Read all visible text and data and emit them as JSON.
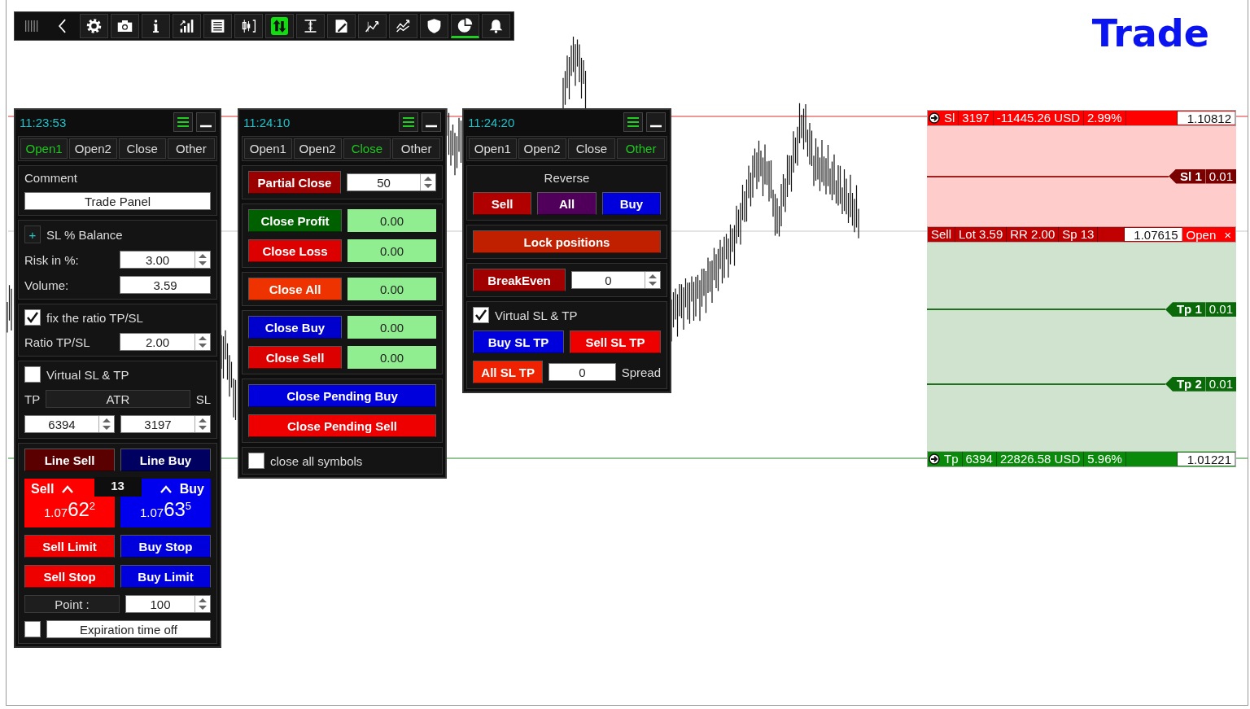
{
  "toolbar": {
    "buttons": [
      {
        "kind": "grip",
        "active": false,
        "marked": false
      },
      {
        "kind": "back",
        "active": false,
        "marked": false
      },
      {
        "kind": "gear",
        "active": false,
        "marked": false
      },
      {
        "kind": "camera",
        "active": false,
        "marked": false
      },
      {
        "kind": "info",
        "active": false,
        "marked": false
      },
      {
        "kind": "signal",
        "active": false,
        "marked": false
      },
      {
        "kind": "list",
        "active": false,
        "marked": false
      },
      {
        "kind": "candles",
        "active": false,
        "marked": false
      },
      {
        "kind": "updown",
        "active": true,
        "marked": false
      },
      {
        "kind": "ibeam",
        "active": false,
        "marked": false
      },
      {
        "kind": "edit",
        "active": false,
        "marked": false
      },
      {
        "kind": "trend",
        "active": false,
        "marked": false
      },
      {
        "kind": "trends",
        "active": false,
        "marked": false
      },
      {
        "kind": "shield",
        "active": false,
        "marked": false
      },
      {
        "kind": "pie",
        "active": false,
        "marked": true
      },
      {
        "kind": "bell",
        "active": false,
        "marked": false
      }
    ]
  },
  "title": "Trade",
  "panels": [
    {
      "time": "11:23:53",
      "tabs": [
        {
          "label": "Open1",
          "selected": true
        },
        {
          "label": "Open2",
          "selected": false
        },
        {
          "label": "Close",
          "selected": false
        },
        {
          "label": "Other",
          "selected": false
        }
      ],
      "sections": [
        {
          "rows": [
            [
              {
                "kind": "label",
                "text": "Comment"
              }
            ],
            [
              {
                "kind": "field",
                "value": "Trade Panel",
                "spinner": false
              }
            ]
          ]
        },
        {
          "rows": [
            [
              {
                "kind": "plus",
                "label": "+"
              },
              {
                "kind": "label",
                "text": "SL % Balance"
              }
            ],
            [
              {
                "kind": "label",
                "text": "Risk in %:"
              },
              {
                "kind": "field",
                "value": "3.00",
                "spinner": true
              }
            ],
            [
              {
                "kind": "label",
                "text": "Volume:"
              },
              {
                "kind": "field",
                "value": "3.59",
                "spinner": false
              }
            ]
          ]
        },
        {
          "rows": [
            [
              {
                "kind": "check",
                "checked": true,
                "label": "fix the ratio TP/SL"
              }
            ],
            [
              {
                "kind": "label",
                "text": "Ratio TP/SL"
              },
              {
                "kind": "field",
                "value": "2.00",
                "spinner": true
              }
            ]
          ]
        },
        {
          "rows": [
            [
              {
                "kind": "check",
                "checked": false,
                "label": "Virtual SL & TP"
              }
            ],
            [
              {
                "kind": "label",
                "text": "TP"
              },
              {
                "kind": "dark",
                "label": "ATR"
              },
              {
                "kind": "label",
                "text": "SL"
              }
            ],
            [
              {
                "kind": "field",
                "value": "6394",
                "spinner": true
              },
              {
                "kind": "field",
                "value": "3197",
                "spinner": true
              }
            ]
          ]
        },
        {
          "rows": [
            [
              {
                "kind": "button",
                "label": "Line Sell",
                "color": "#5a0000"
              },
              {
                "kind": "button",
                "label": "Line Buy",
                "color": "#000060"
              }
            ],
            [
              {
                "kind": "quote",
                "sell": {
                  "label": "Sell",
                  "price": "1.07",
                  "big": "62",
                  "point": "2"
                },
                "spread": "13",
                "buy": {
                  "label": "Buy",
                  "price": "1.07",
                  "big": "63",
                  "point": "5"
                }
              }
            ],
            [
              {
                "kind": "button",
                "label": "Sell Limit",
                "color": "#ee0000"
              },
              {
                "kind": "button",
                "label": "Buy Stop",
                "color": "#0000dd"
              }
            ],
            [
              {
                "kind": "button",
                "label": "Sell Stop",
                "color": "#ee0000"
              },
              {
                "kind": "button",
                "label": "Buy Limit",
                "color": "#0000dd"
              }
            ],
            [
              {
                "kind": "dark",
                "label": "Point :"
              },
              {
                "kind": "field",
                "value": "100",
                "spinner": true
              }
            ],
            [
              {
                "kind": "check",
                "checked": false
              },
              {
                "kind": "field",
                "value": "Expiration time off",
                "spinner": false
              }
            ]
          ]
        }
      ]
    },
    {
      "time": "11:24:10",
      "tabs": [
        {
          "label": "Open1",
          "selected": false
        },
        {
          "label": "Open2",
          "selected": false
        },
        {
          "label": "Close",
          "selected": true
        },
        {
          "label": "Other",
          "selected": false
        }
      ],
      "sections": [
        {
          "rows": [
            [
              {
                "kind": "button",
                "label": "Partial Close",
                "color": "#9a0000"
              },
              {
                "kind": "field",
                "value": "50",
                "spinner": true
              }
            ]
          ]
        },
        {
          "rows": [
            [
              {
                "kind": "button",
                "label": "Close Profit",
                "color": "#006000"
              },
              {
                "kind": "value",
                "value": "0.00"
              }
            ],
            [
              {
                "kind": "button",
                "label": "Close Loss",
                "color": "#dd0000"
              },
              {
                "kind": "value",
                "value": "0.00"
              }
            ]
          ]
        },
        {
          "rows": [
            [
              {
                "kind": "button",
                "label": "Close All",
                "color": "#ee3300"
              },
              {
                "kind": "value",
                "value": "0.00"
              }
            ]
          ]
        },
        {
          "rows": [
            [
              {
                "kind": "button",
                "label": "Close Buy",
                "color": "#0000cc"
              },
              {
                "kind": "value",
                "value": "0.00"
              }
            ],
            [
              {
                "kind": "button",
                "label": "Close Sell",
                "color": "#dd0000"
              },
              {
                "kind": "value",
                "value": "0.00"
              }
            ]
          ]
        },
        {
          "rows": [
            [
              {
                "kind": "button",
                "label": "Close Pending Buy",
                "color": "#0000dd"
              }
            ],
            [
              {
                "kind": "button",
                "label": "Close Pending Sell",
                "color": "#ee0000"
              }
            ]
          ]
        },
        {
          "rows": [
            [
              {
                "kind": "check",
                "checked": false,
                "label": "close all symbols"
              }
            ]
          ]
        }
      ]
    },
    {
      "time": "11:24:20",
      "tabs": [
        {
          "label": "Open1",
          "selected": false
        },
        {
          "label": "Open2",
          "selected": false
        },
        {
          "label": "Close",
          "selected": false
        },
        {
          "label": "Other",
          "selected": true
        }
      ],
      "sections": [
        {
          "heading": "Reverse",
          "rows": [
            [
              {
                "kind": "button",
                "label": "Sell",
                "color": "#b00000"
              },
              {
                "kind": "button",
                "label": "All",
                "color": "#50005a"
              },
              {
                "kind": "button",
                "label": "Buy",
                "color": "#0000dd"
              }
            ]
          ]
        },
        {
          "rows": [
            [
              {
                "kind": "button",
                "label": "Lock positions",
                "color": "#c02000"
              }
            ]
          ]
        },
        {
          "rows": [
            [
              {
                "kind": "button",
                "label": "BreakEven",
                "color": "#a00000"
              },
              {
                "kind": "field",
                "value": "0",
                "spinner": true
              }
            ]
          ]
        },
        {
          "rows": [
            [
              {
                "kind": "check",
                "checked": true,
                "label": "Virtual SL & TP"
              }
            ],
            [
              {
                "kind": "button",
                "label": "Buy SL TP",
                "color": "#0000dd"
              },
              {
                "kind": "button",
                "label": "Sell SL TP",
                "color": "#ee0000"
              }
            ],
            [
              {
                "kind": "button",
                "label": "All SL TP",
                "color": "#ee2200"
              },
              {
                "kind": "field",
                "value": "0",
                "spinner": false
              },
              {
                "kind": "label",
                "text": "Spread"
              }
            ]
          ]
        }
      ]
    }
  ],
  "trade_zone": {
    "stop_loss_bar": {
      "cells": [
        "Sl",
        "3197",
        "-11445.26 USD",
        "2.99%"
      ],
      "price": "1.10812"
    },
    "stop_loss_levels": [
      {
        "label": "Sl 1",
        "volume": "0.01"
      }
    ],
    "entry_bar": {
      "cells": [
        "Sell",
        "Lot 3.59",
        "RR 2.00",
        "Sp 13"
      ],
      "price": "1.07615",
      "open": "Open",
      "close": "×"
    },
    "take_profit_levels": [
      {
        "label": "Tp 1",
        "volume": "0.01"
      },
      {
        "label": "Tp 2",
        "volume": "0.01"
      }
    ],
    "take_profit_bar": {
      "cells": [
        "Tp",
        "6394",
        "22826.58 USD",
        "5.96%"
      ],
      "price": "1.01221"
    }
  }
}
